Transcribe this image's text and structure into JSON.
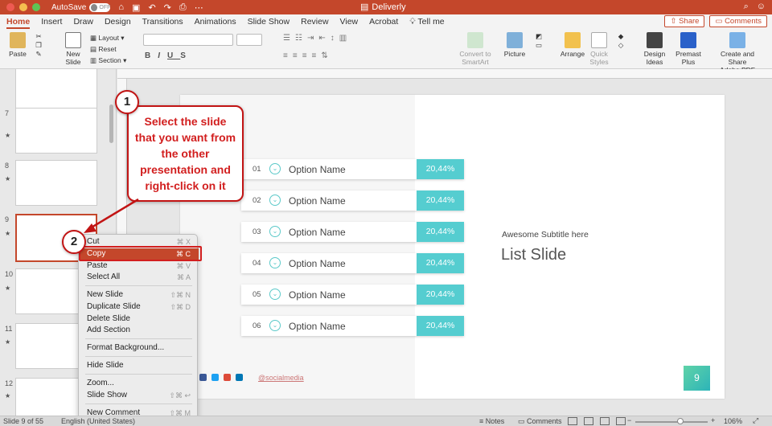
{
  "window": {
    "autosave_label": "AutoSave",
    "autosave_state": "OFF",
    "doc_title": "Deliverly"
  },
  "ribbon_tabs": [
    "Home",
    "Insert",
    "Draw",
    "Design",
    "Transitions",
    "Animations",
    "Slide Show",
    "Review",
    "View",
    "Acrobat",
    "Tell me"
  ],
  "ribbon_right": {
    "share": "Share",
    "comments": "Comments"
  },
  "ribbon": {
    "paste": "Paste",
    "new_slide_1": "New",
    "new_slide_2": "Slide",
    "layout": "Layout",
    "reset": "Reset",
    "section": "Section",
    "convert_1": "Convert to",
    "convert_2": "SmartArt",
    "picture": "Picture",
    "arrange": "Arrange",
    "quick_styles_1": "Quick",
    "quick_styles_2": "Styles",
    "design_ideas_1": "Design",
    "design_ideas_2": "Ideas",
    "premast_1": "Premast",
    "premast_2": "Plus",
    "create_share_1": "Create and Share",
    "create_share_2": "Adobe PDF"
  },
  "thumbnails": {
    "numbers": [
      "7",
      "8",
      "9",
      "10",
      "11",
      "12"
    ]
  },
  "slide": {
    "options": [
      {
        "num": "01",
        "name": "Option Name",
        "pct": "20,44%"
      },
      {
        "num": "02",
        "name": "Option Name",
        "pct": "20,44%"
      },
      {
        "num": "03",
        "name": "Option Name",
        "pct": "20,44%"
      },
      {
        "num": "04",
        "name": "Option Name",
        "pct": "20,44%"
      },
      {
        "num": "05",
        "name": "Option Name",
        "pct": "20,44%"
      },
      {
        "num": "06",
        "name": "Option Name",
        "pct": "20,44%"
      }
    ],
    "subtitle": "Awesome Subtitle here",
    "title": "List Slide",
    "social_handle": "@socialmedia",
    "page_number": "9"
  },
  "context_menu": {
    "items": [
      {
        "label": "Cut",
        "shortcut": "⌘ X"
      },
      {
        "label": "Copy",
        "shortcut": "⌘ C"
      },
      {
        "label": "Paste",
        "shortcut": "⌘ V"
      },
      {
        "label": "Select All",
        "shortcut": "⌘ A"
      },
      {
        "label": "New Slide",
        "shortcut": "⇧⌘ N"
      },
      {
        "label": "Duplicate Slide",
        "shortcut": "⇧⌘ D"
      },
      {
        "label": "Delete Slide",
        "shortcut": ""
      },
      {
        "label": "Add Section",
        "shortcut": ""
      },
      {
        "label": "Format Background...",
        "shortcut": ""
      },
      {
        "label": "Hide Slide",
        "shortcut": ""
      },
      {
        "label": "Zoom...",
        "shortcut": ""
      },
      {
        "label": "Slide Show",
        "shortcut": "⇧⌘ ↩"
      },
      {
        "label": "New Comment",
        "shortcut": "⇧⌘ M"
      }
    ]
  },
  "callout": {
    "step1": "1",
    "step2": "2",
    "text": "Select the slide that you want from the other presentation and right-click on it"
  },
  "status": {
    "slide_of": "Slide 9 of 55",
    "language": "English (United States)",
    "notes": "Notes",
    "comments": "Comments",
    "zoom": "106%"
  },
  "colors": {
    "accent": "#c4472b",
    "teal": "#55cdd0",
    "callout_red": "#d21f1f"
  }
}
